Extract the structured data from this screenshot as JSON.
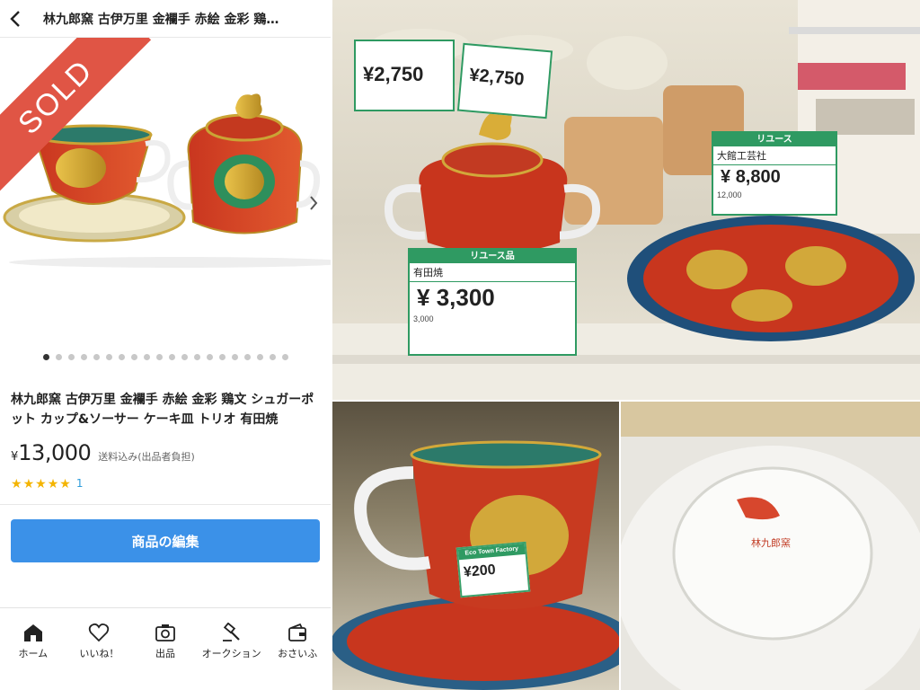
{
  "header": {
    "title": "林九郎窯 古伊万里 金襴手 赤絵 金彩 鶏…"
  },
  "gallery": {
    "badge": "SOLD",
    "dot_count": 20,
    "active_dot": 0
  },
  "product": {
    "title": "林九郎窯 古伊万里 金襴手 赤絵 金彩 鶏文 シュガーポット カップ&ソーサー ケーキ皿 トリオ 有田焼",
    "currency": "¥",
    "price": "13,000",
    "shipping": "送料込み(出品者負担)",
    "rating_stars": 5,
    "rating_count": "1",
    "edit_button": "商品の編集"
  },
  "tabbar": {
    "items": [
      {
        "label": "ホーム",
        "icon": "home-icon"
      },
      {
        "label": "いいね！",
        "icon": "heart-icon"
      },
      {
        "label": "出品",
        "icon": "camera-icon"
      },
      {
        "label": "オークション",
        "icon": "gavel-icon"
      },
      {
        "label": "おさいふ",
        "icon": "wallet-icon"
      }
    ]
  },
  "photos": {
    "main_tag": {
      "header": "リユース品",
      "maker": "有田焼",
      "price": "3,300",
      "currency": "¥",
      "old_price": "3,000"
    },
    "bowl_tag_1": {
      "price": "2,750",
      "currency": "¥"
    },
    "bowl_tag_2": {
      "price": "2,750",
      "currency": "¥"
    },
    "cup_tag": {
      "header": "リユース",
      "maker": "大館工芸社",
      "price": "8,800",
      "currency": "¥",
      "old_price": "12,000"
    },
    "cup_sticker": {
      "header": "Eco Town Factory",
      "price": "¥200"
    },
    "back_stamp": "林九郎窯"
  },
  "colors": {
    "accent": "#3b91e8",
    "sold": "#e05545",
    "star": "#f4b400",
    "tag_green": "#2f9a62"
  }
}
